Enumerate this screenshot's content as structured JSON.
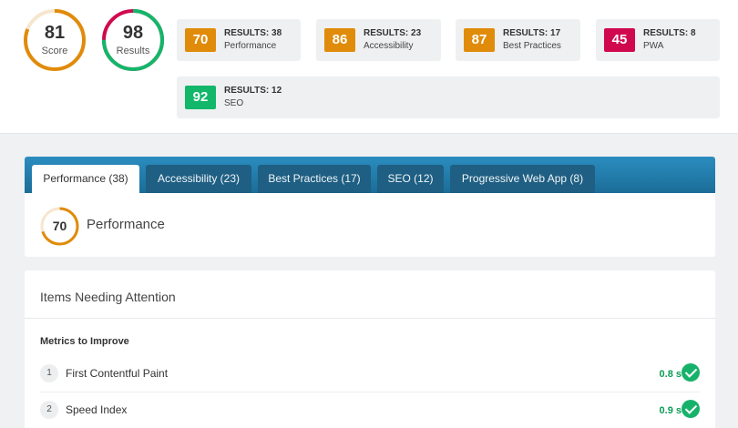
{
  "summary": {
    "score": {
      "value": "81",
      "label": "Score",
      "percent": 81,
      "color": "#e08b0a"
    },
    "results": {
      "value": "98",
      "label": "Results",
      "percent": 75,
      "color": "#12b76a",
      "secondary_color": "#d0094f"
    }
  },
  "categories": [
    {
      "score": "70",
      "results": "RESULTS: 38",
      "name": "Performance",
      "color": "#e08b0a"
    },
    {
      "score": "86",
      "results": "RESULTS: 23",
      "name": "Accessibility",
      "color": "#e08b0a"
    },
    {
      "score": "87",
      "results": "RESULTS: 17",
      "name": "Best Practices",
      "color": "#e08b0a"
    },
    {
      "score": "45",
      "results": "RESULTS: 8",
      "name": "PWA",
      "color": "#d0094f"
    },
    {
      "score": "92",
      "results": "RESULTS: 12",
      "name": "SEO",
      "color": "#12b76a"
    }
  ],
  "tabs": [
    "Performance (38)",
    "Accessibility (23)",
    "Best Practices (17)",
    "SEO (12)",
    "Progressive Web App (8)"
  ],
  "active_tab": 0,
  "performance": {
    "score": "70",
    "title": "Performance",
    "percent": 70,
    "color": "#e08b0a"
  },
  "attention": {
    "title": "Items Needing Attention",
    "subtitle": "Metrics to Improve",
    "metrics": [
      {
        "index": "1",
        "name": "First Contentful Paint",
        "value": "0.8 s",
        "status": "pass"
      },
      {
        "index": "2",
        "name": "Speed Index",
        "value": "0.9 s",
        "status": "pass"
      }
    ]
  },
  "icons": {
    "check": "check-circle-icon"
  }
}
